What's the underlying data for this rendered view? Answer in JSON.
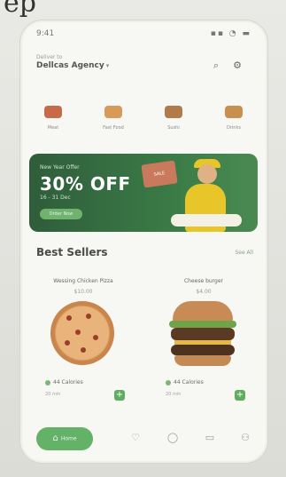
{
  "status_bar": {
    "time": "9:41",
    "signal_icons": "▪▪ ◔ ▬"
  },
  "location": {
    "label": "Deliver to",
    "value": "Dellcas Agency",
    "caret": "▾"
  },
  "header_actions": {
    "search_icon": "⌕",
    "settings_icon": "⚙"
  },
  "categories": [
    {
      "label": "Meat",
      "color": "#c76a4a"
    },
    {
      "label": "Fast Food",
      "color": "#d89a58"
    },
    {
      "label": "Sushi",
      "color": "#b07a4b"
    },
    {
      "label": "Drinks",
      "color": "#c98f4e"
    }
  ],
  "promo": {
    "kicker": "New Year Offer",
    "headline": "30% OFF",
    "dates": "16 - 31 Dec",
    "cta": "Order Now",
    "sign_text": "SALE"
  },
  "best_sellers": {
    "title": "Best Sellers",
    "see_all": "See All",
    "items": [
      {
        "name": "Wessing Chicken Pizza",
        "price": "$10.00",
        "calories": "44 Calories",
        "time": "20 min"
      },
      {
        "name": "Cheese burger",
        "price": "$4.00",
        "calories": "44 Calories",
        "time": "20 min"
      }
    ],
    "add_label": "+"
  },
  "nav": {
    "home_label": "Home",
    "home_icon": "⌂",
    "icons": [
      "♡",
      "◯",
      "▭",
      "⚇"
    ]
  },
  "colors": {
    "accent": "#5fae5f",
    "promo_bg": "#2f5d3a"
  }
}
